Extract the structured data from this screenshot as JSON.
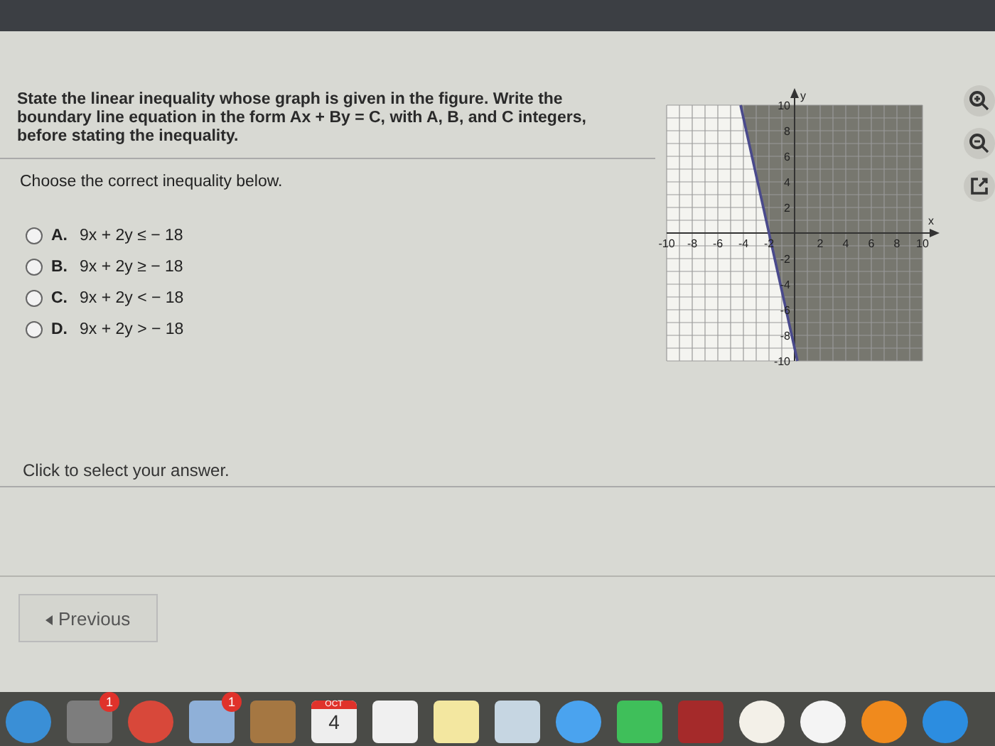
{
  "question": {
    "prompt": "State the linear inequality whose graph is given in the figure. Write the boundary line equation in the form Ax + By = C, with A, B, and C integers, before stating the inequality.",
    "instruction": "Choose the correct inequality below.",
    "options": [
      {
        "letter": "A.",
        "text": "9x + 2y ≤ − 18",
        "selected": false
      },
      {
        "letter": "B.",
        "text": "9x + 2y ≥ − 18",
        "selected": false
      },
      {
        "letter": "C.",
        "text": "9x + 2y < − 18",
        "selected": false
      },
      {
        "letter": "D.",
        "text": "9x + 2y > − 18",
        "selected": false
      }
    ]
  },
  "graph": {
    "x_axis_label": "x",
    "y_axis_label": "y",
    "chart_data": {
      "type": "line",
      "x": [
        -4.222,
        0.222
      ],
      "xlim": [
        -10,
        10
      ],
      "ylim": [
        -10,
        10
      ],
      "xticks": [
        -10,
        -8,
        -6,
        -4,
        -2,
        2,
        4,
        6,
        8,
        10
      ],
      "yticks": [
        -10,
        -8,
        -6,
        -4,
        -2,
        2,
        4,
        6,
        8,
        10
      ],
      "grid": true,
      "series": [
        {
          "color": "#4a4a8c",
          "values": [
            10,
            -10
          ]
        }
      ]
    }
  },
  "status": "Click to select your answer.",
  "previous_button": "Previous",
  "dock": {
    "badges": [
      "1",
      "1"
    ],
    "calendar_month": "OCT",
    "calendar_day": "4"
  }
}
